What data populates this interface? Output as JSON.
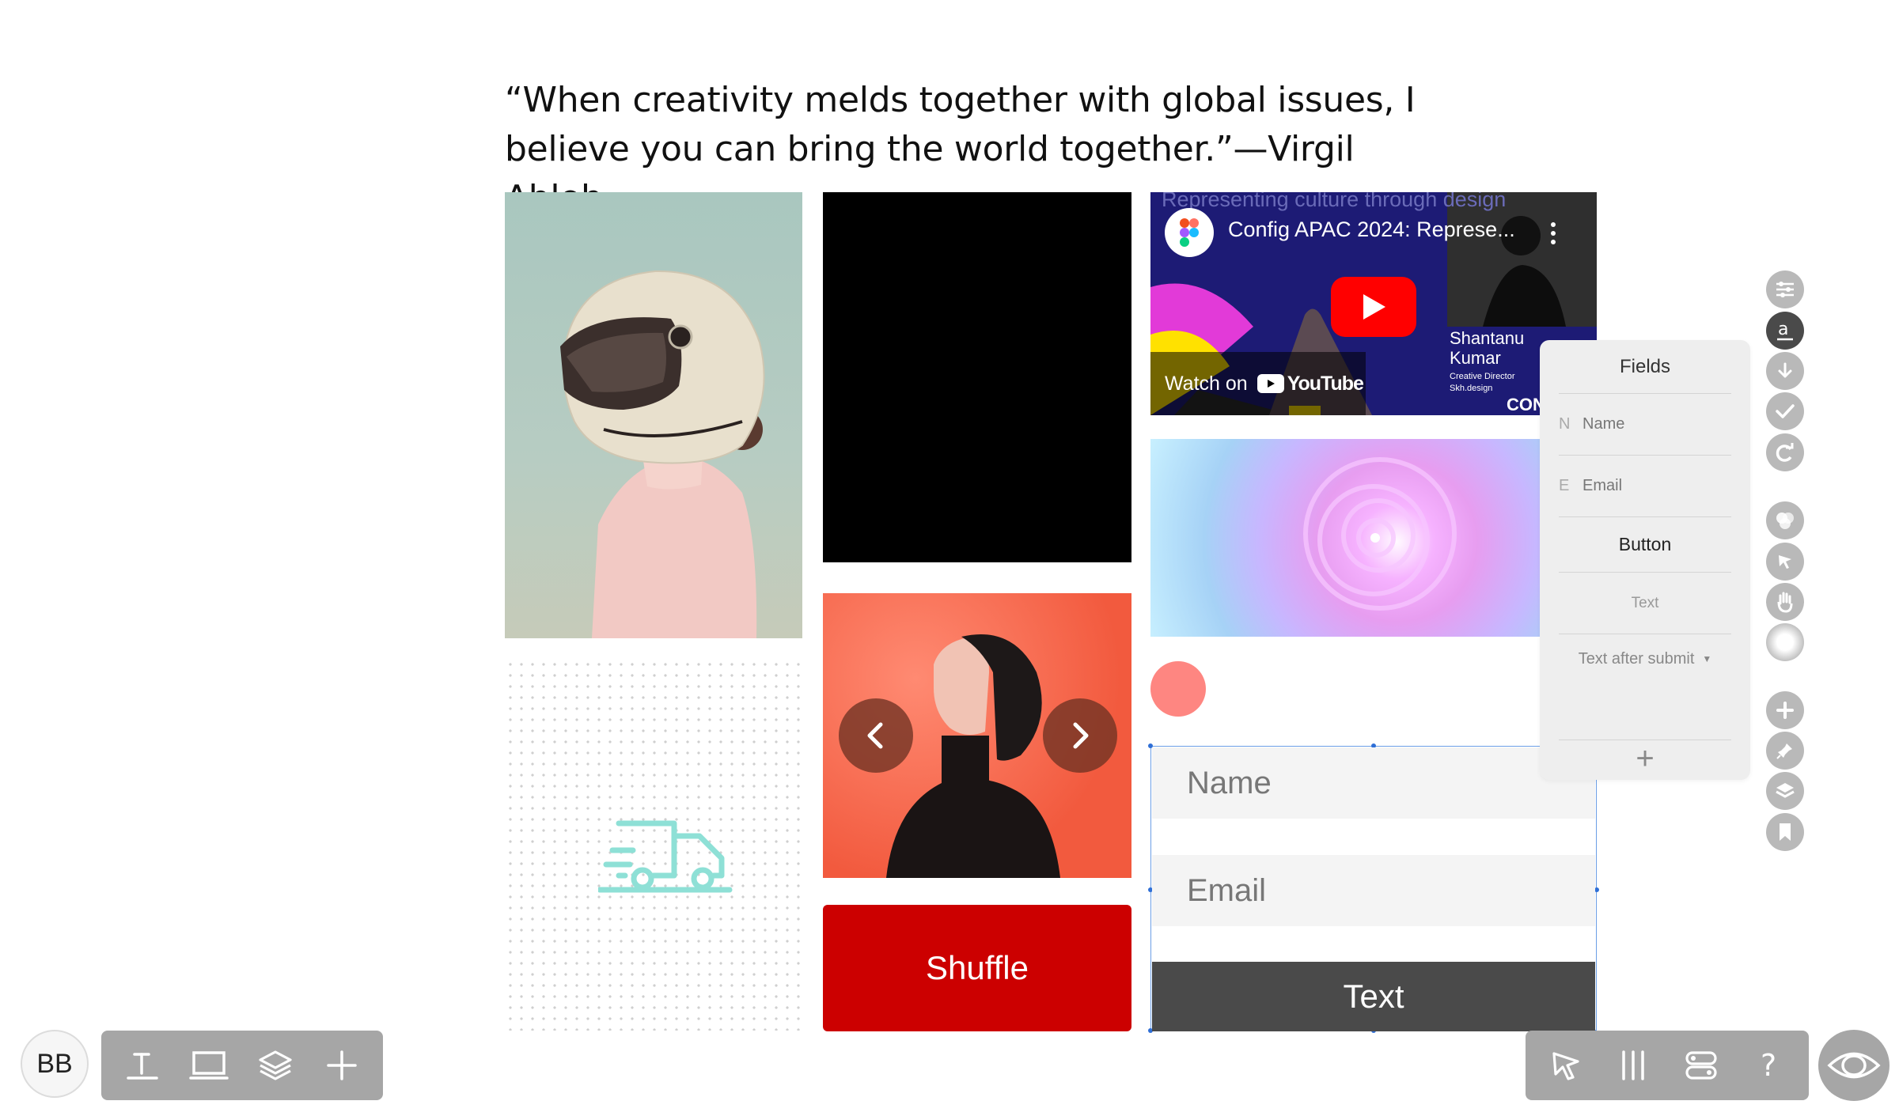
{
  "quote": {
    "line1": "“When creativity melds together with global issues, I",
    "line2": "believe you can bring the world together.”—Virgil Abloh"
  },
  "video": {
    "bg_text": "Representing culture through design",
    "title": "Config APAC 2024: Represe...",
    "watch_on": "Watch on",
    "youtube": "YouTube",
    "speaker_name_1": "Shantanu",
    "speaker_name_2": "Kumar",
    "speaker_role": "Creative Director",
    "speaker_company": "Skh.design",
    "brand_mark": "CONFIG"
  },
  "shuffle_label": "Shuffle",
  "form": {
    "name_placeholder": "Name",
    "email_placeholder": "Email",
    "button_label": "Text"
  },
  "fields_panel": {
    "title": "Fields",
    "name_prefix": "N",
    "name_label": "Name",
    "email_prefix": "E",
    "email_label": "Email",
    "button_label": "Button",
    "text_label": "Text",
    "after_submit_label": "Text after submit",
    "add_glyph": "+"
  },
  "avatar_initials": "BB",
  "tools_right": [
    "sliders-icon",
    "text-a-icon",
    "download-icon",
    "check-icon",
    "redo-icon",
    "circles-icon",
    "cursor-icon",
    "hand-icon",
    "blur-icon",
    "add-icon",
    "pin-icon",
    "layers-icon",
    "bookmark-icon"
  ],
  "toolbar_left": [
    "text-tool-icon",
    "device-icon",
    "layers-icon",
    "add-icon"
  ],
  "toolbar_right": [
    "pointer-icon",
    "columns-icon",
    "toggle-icon",
    "help-icon"
  ],
  "colors": {
    "shuffle_red": "#cc0000",
    "toolbar_grey": "#a6a6a6",
    "form_button": "#4a4a4a",
    "selection_blue": "#6b9ee6",
    "truck_teal": "#8ee0d6",
    "dot_coral": "#fe8681"
  }
}
